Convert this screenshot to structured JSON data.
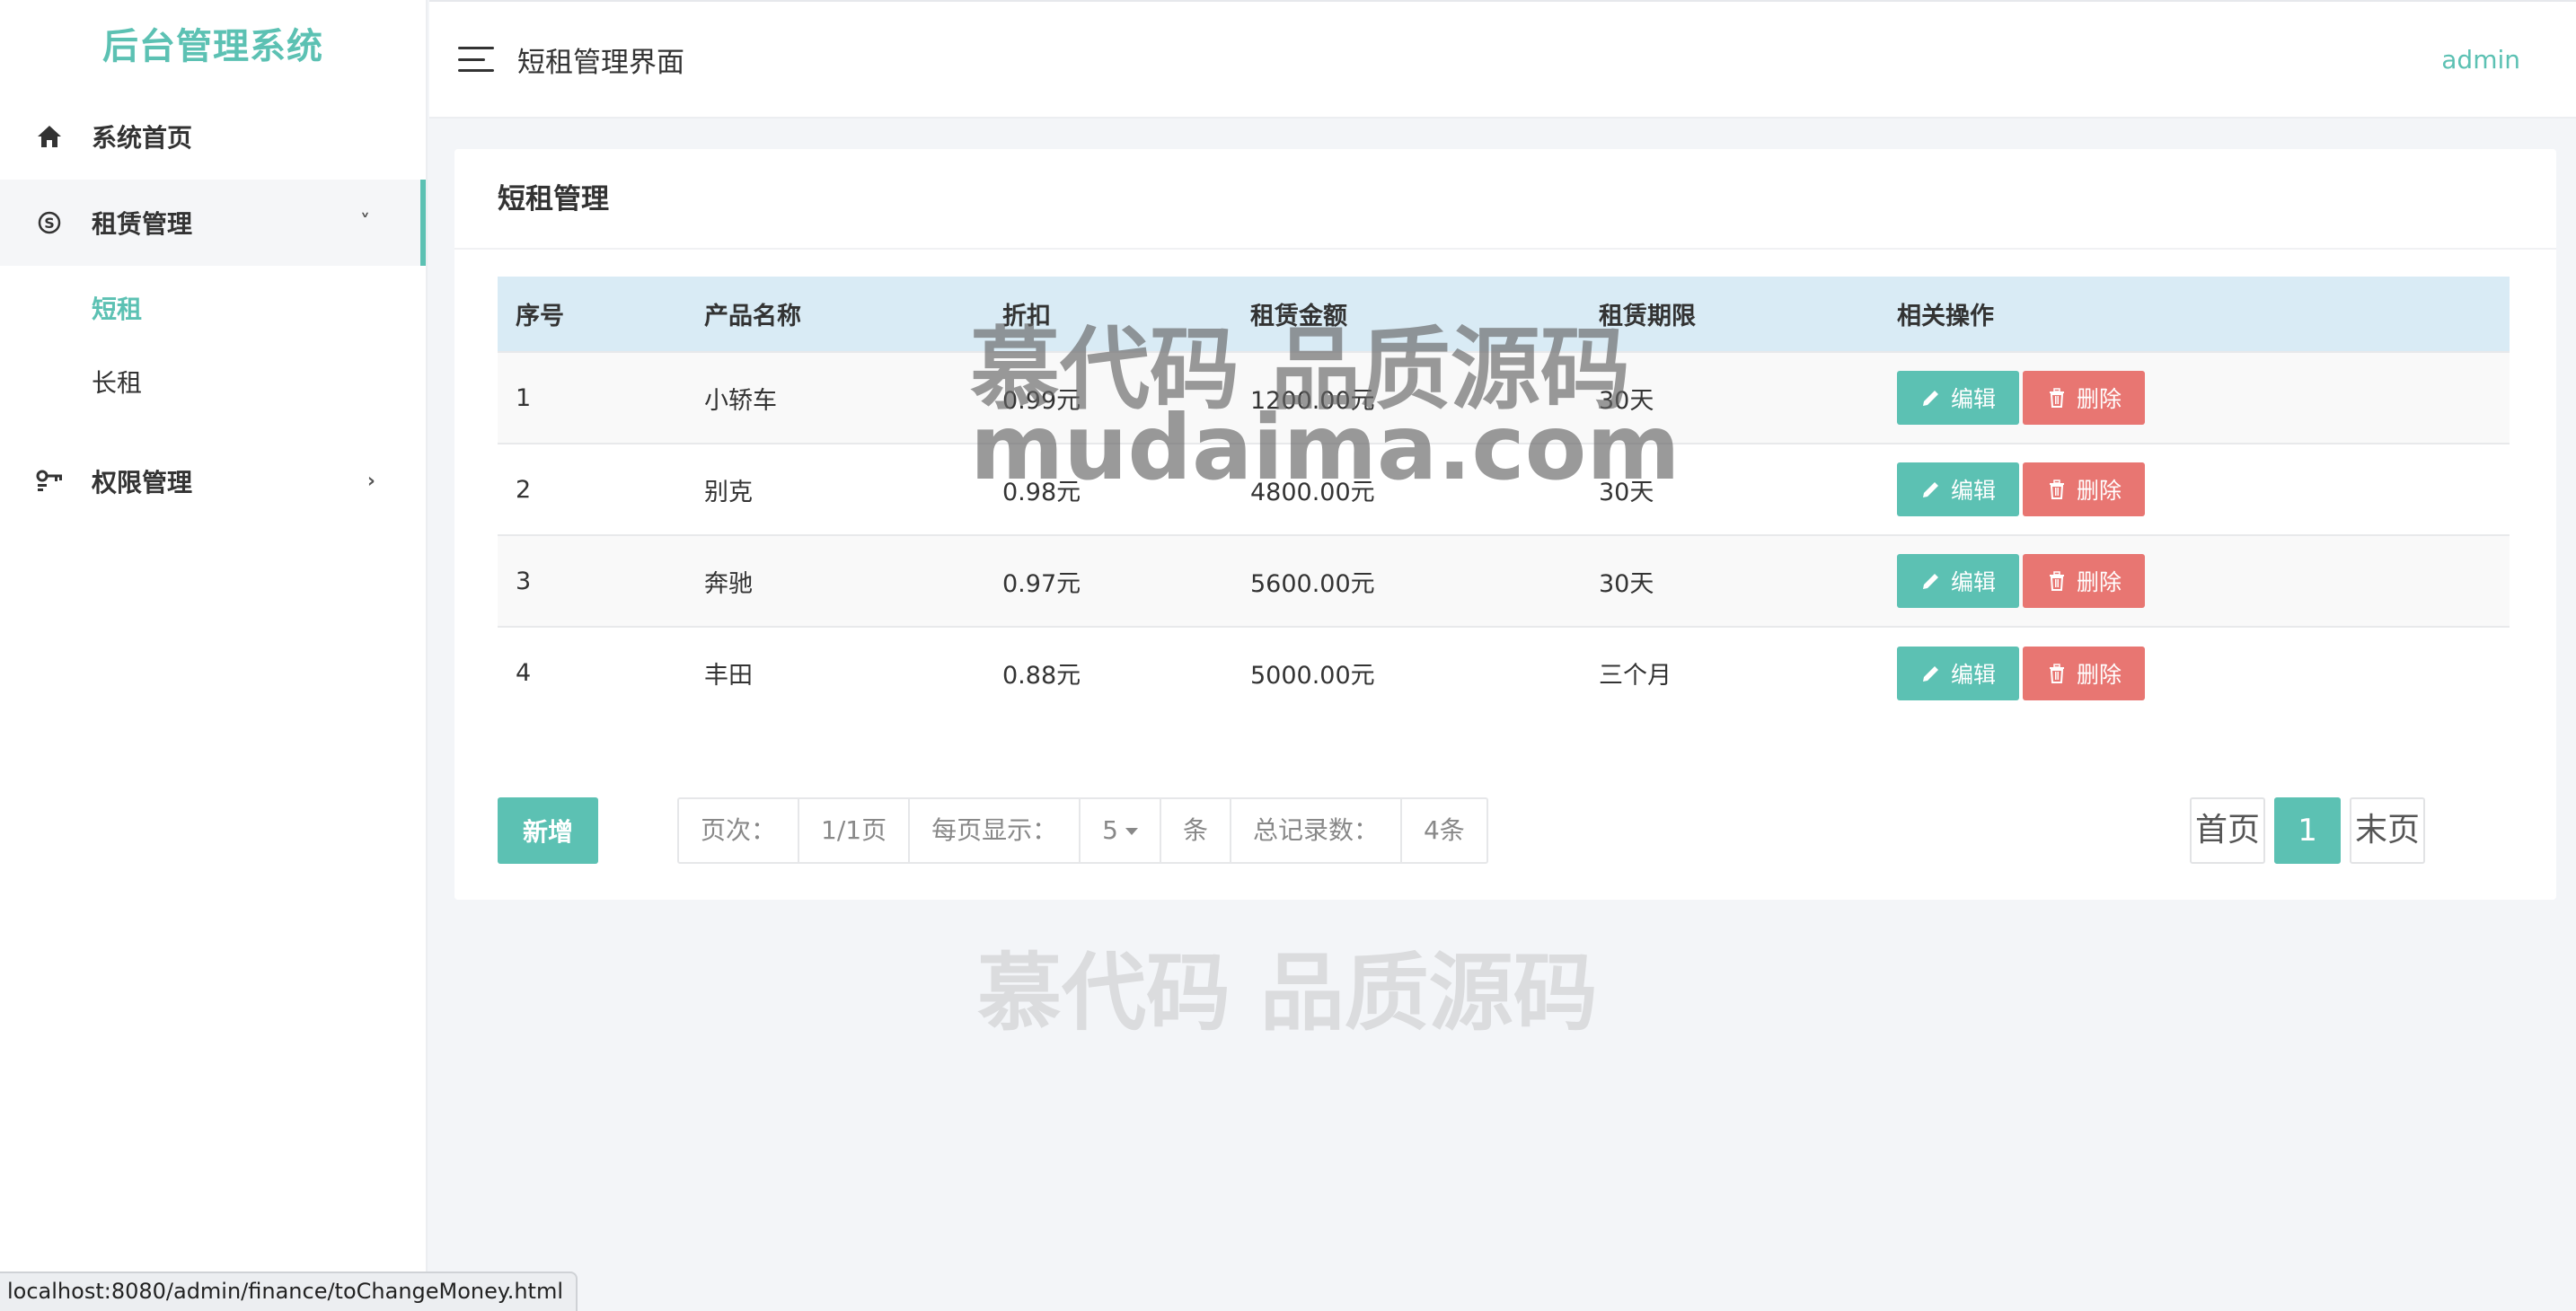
{
  "brand": "后台管理系统",
  "sidebar": {
    "items": [
      {
        "label": "系统首页",
        "icon": "home-icon"
      },
      {
        "label": "租赁管理",
        "icon": "skype-icon",
        "chevron": "˅"
      },
      {
        "label": "权限管理",
        "icon": "key-icon",
        "chevron": "›"
      }
    ],
    "sub_items": [
      "短租",
      "长租"
    ]
  },
  "header": {
    "title": "短租管理界面",
    "user": "admin"
  },
  "card": {
    "title": "短租管理"
  },
  "table": {
    "columns": [
      "序号",
      "产品名称",
      "折扣",
      "租赁金额",
      "租赁期限",
      "相关操作"
    ],
    "rows": [
      [
        "1",
        "小轿车",
        "0.99元",
        "1200.00元",
        "30天"
      ],
      [
        "2",
        "别克",
        "0.98元",
        "4800.00元",
        "30天"
      ],
      [
        "3",
        "奔驰",
        "0.97元",
        "5600.00元",
        "30天"
      ],
      [
        "4",
        "丰田",
        "0.88元",
        "5000.00元",
        "三个月"
      ]
    ],
    "edit_label": "编辑",
    "delete_label": "删除"
  },
  "footer": {
    "add_label": "新增",
    "page_label": "页次：",
    "page_value": "1/1页",
    "per_page_label": "每页显示：",
    "per_page_value": "5",
    "per_page_unit": "条",
    "total_label": "总记录数：",
    "total_value": "4条",
    "first_label": "首页",
    "current_page": "1",
    "last_label": "末页"
  },
  "watermark": {
    "line1": "慕代码 品质源码",
    "line2": "mudaima.com"
  },
  "status_url": "localhost:8080/admin/finance/toChangeMoney.html",
  "colors": {
    "accent": "#5cc1b3",
    "danger": "#e87672",
    "table_header": "#d9ebf5"
  }
}
